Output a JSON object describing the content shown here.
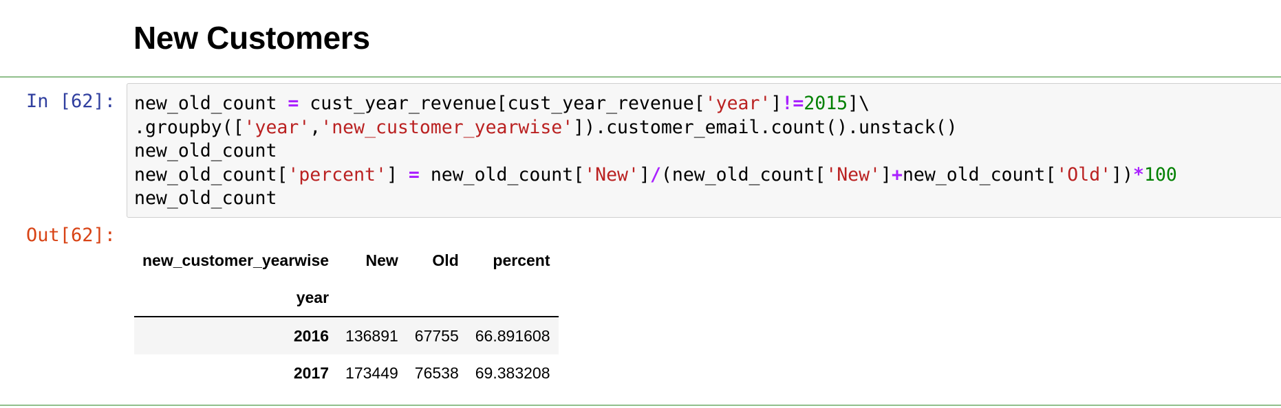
{
  "heading": "New Customers",
  "input_prompt": "In [62]:",
  "output_prompt": "Out[62]:",
  "code_tokens": [
    [
      {
        "t": "new_old_count ",
        "c": ""
      },
      {
        "t": "=",
        "c": "op"
      },
      {
        "t": " cust_year_revenue[cust_year_revenue[",
        "c": ""
      },
      {
        "t": "'year'",
        "c": "str"
      },
      {
        "t": "]",
        "c": ""
      },
      {
        "t": "!=",
        "c": "op"
      },
      {
        "t": "2015",
        "c": "num"
      },
      {
        "t": "]\\",
        "c": ""
      }
    ],
    [
      {
        "t": ".groupby([",
        "c": ""
      },
      {
        "t": "'year'",
        "c": "str"
      },
      {
        "t": ",",
        "c": ""
      },
      {
        "t": "'new_customer_yearwise'",
        "c": "str"
      },
      {
        "t": "]).customer_email.count().unstack()",
        "c": ""
      }
    ],
    [
      {
        "t": "new_old_count",
        "c": ""
      }
    ],
    [
      {
        "t": "new_old_count[",
        "c": ""
      },
      {
        "t": "'percent'",
        "c": "str"
      },
      {
        "t": "] ",
        "c": ""
      },
      {
        "t": "=",
        "c": "op"
      },
      {
        "t": " new_old_count[",
        "c": ""
      },
      {
        "t": "'New'",
        "c": "str"
      },
      {
        "t": "]",
        "c": ""
      },
      {
        "t": "/",
        "c": "op"
      },
      {
        "t": "(new_old_count[",
        "c": ""
      },
      {
        "t": "'New'",
        "c": "str"
      },
      {
        "t": "]",
        "c": ""
      },
      {
        "t": "+",
        "c": "op"
      },
      {
        "t": "new_old_count[",
        "c": ""
      },
      {
        "t": "'Old'",
        "c": "str"
      },
      {
        "t": "])",
        "c": ""
      },
      {
        "t": "*",
        "c": "op"
      },
      {
        "t": "100",
        "c": "num"
      }
    ],
    [
      {
        "t": "new_old_count",
        "c": ""
      }
    ]
  ],
  "table": {
    "columns_name": "new_customer_yearwise",
    "columns": [
      "New",
      "Old",
      "percent"
    ],
    "index_name": "year",
    "rows": [
      {
        "index": "2016",
        "values": [
          "136891",
          "67755",
          "66.891608"
        ]
      },
      {
        "index": "2017",
        "values": [
          "173449",
          "76538",
          "69.383208"
        ]
      }
    ]
  },
  "colors": {
    "input_prompt": "#303f9f",
    "output_prompt": "#d84315",
    "operator": "#aa22ff",
    "string": "#ba2121",
    "number": "#008000",
    "cell_border": "#8fbf8a"
  }
}
